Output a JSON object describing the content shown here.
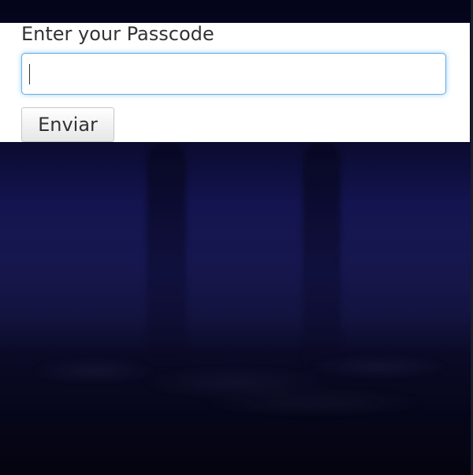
{
  "form": {
    "label": "Enter your Passcode",
    "input_value": "",
    "input_placeholder": "",
    "submit_label": "Enviar"
  },
  "colors": {
    "focus_border": "#66afe9",
    "backdrop": "#141450",
    "text": "#333333"
  }
}
